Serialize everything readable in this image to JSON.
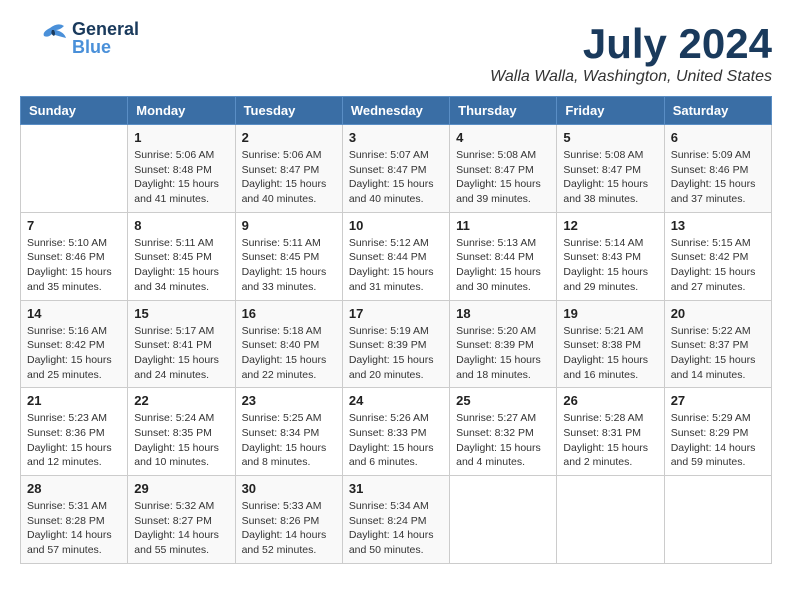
{
  "header": {
    "logo_general": "General",
    "logo_blue": "Blue",
    "month_title": "July 2024",
    "location": "Walla Walla, Washington, United States"
  },
  "days_of_week": [
    "Sunday",
    "Monday",
    "Tuesday",
    "Wednesday",
    "Thursday",
    "Friday",
    "Saturday"
  ],
  "weeks": [
    [
      {
        "day": "",
        "info": ""
      },
      {
        "day": "1",
        "info": "Sunrise: 5:06 AM\nSunset: 8:48 PM\nDaylight: 15 hours\nand 41 minutes."
      },
      {
        "day": "2",
        "info": "Sunrise: 5:06 AM\nSunset: 8:47 PM\nDaylight: 15 hours\nand 40 minutes."
      },
      {
        "day": "3",
        "info": "Sunrise: 5:07 AM\nSunset: 8:47 PM\nDaylight: 15 hours\nand 40 minutes."
      },
      {
        "day": "4",
        "info": "Sunrise: 5:08 AM\nSunset: 8:47 PM\nDaylight: 15 hours\nand 39 minutes."
      },
      {
        "day": "5",
        "info": "Sunrise: 5:08 AM\nSunset: 8:47 PM\nDaylight: 15 hours\nand 38 minutes."
      },
      {
        "day": "6",
        "info": "Sunrise: 5:09 AM\nSunset: 8:46 PM\nDaylight: 15 hours\nand 37 minutes."
      }
    ],
    [
      {
        "day": "7",
        "info": "Sunrise: 5:10 AM\nSunset: 8:46 PM\nDaylight: 15 hours\nand 35 minutes."
      },
      {
        "day": "8",
        "info": "Sunrise: 5:11 AM\nSunset: 8:45 PM\nDaylight: 15 hours\nand 34 minutes."
      },
      {
        "day": "9",
        "info": "Sunrise: 5:11 AM\nSunset: 8:45 PM\nDaylight: 15 hours\nand 33 minutes."
      },
      {
        "day": "10",
        "info": "Sunrise: 5:12 AM\nSunset: 8:44 PM\nDaylight: 15 hours\nand 31 minutes."
      },
      {
        "day": "11",
        "info": "Sunrise: 5:13 AM\nSunset: 8:44 PM\nDaylight: 15 hours\nand 30 minutes."
      },
      {
        "day": "12",
        "info": "Sunrise: 5:14 AM\nSunset: 8:43 PM\nDaylight: 15 hours\nand 29 minutes."
      },
      {
        "day": "13",
        "info": "Sunrise: 5:15 AM\nSunset: 8:42 PM\nDaylight: 15 hours\nand 27 minutes."
      }
    ],
    [
      {
        "day": "14",
        "info": "Sunrise: 5:16 AM\nSunset: 8:42 PM\nDaylight: 15 hours\nand 25 minutes."
      },
      {
        "day": "15",
        "info": "Sunrise: 5:17 AM\nSunset: 8:41 PM\nDaylight: 15 hours\nand 24 minutes."
      },
      {
        "day": "16",
        "info": "Sunrise: 5:18 AM\nSunset: 8:40 PM\nDaylight: 15 hours\nand 22 minutes."
      },
      {
        "day": "17",
        "info": "Sunrise: 5:19 AM\nSunset: 8:39 PM\nDaylight: 15 hours\nand 20 minutes."
      },
      {
        "day": "18",
        "info": "Sunrise: 5:20 AM\nSunset: 8:39 PM\nDaylight: 15 hours\nand 18 minutes."
      },
      {
        "day": "19",
        "info": "Sunrise: 5:21 AM\nSunset: 8:38 PM\nDaylight: 15 hours\nand 16 minutes."
      },
      {
        "day": "20",
        "info": "Sunrise: 5:22 AM\nSunset: 8:37 PM\nDaylight: 15 hours\nand 14 minutes."
      }
    ],
    [
      {
        "day": "21",
        "info": "Sunrise: 5:23 AM\nSunset: 8:36 PM\nDaylight: 15 hours\nand 12 minutes."
      },
      {
        "day": "22",
        "info": "Sunrise: 5:24 AM\nSunset: 8:35 PM\nDaylight: 15 hours\nand 10 minutes."
      },
      {
        "day": "23",
        "info": "Sunrise: 5:25 AM\nSunset: 8:34 PM\nDaylight: 15 hours\nand 8 minutes."
      },
      {
        "day": "24",
        "info": "Sunrise: 5:26 AM\nSunset: 8:33 PM\nDaylight: 15 hours\nand 6 minutes."
      },
      {
        "day": "25",
        "info": "Sunrise: 5:27 AM\nSunset: 8:32 PM\nDaylight: 15 hours\nand 4 minutes."
      },
      {
        "day": "26",
        "info": "Sunrise: 5:28 AM\nSunset: 8:31 PM\nDaylight: 15 hours\nand 2 minutes."
      },
      {
        "day": "27",
        "info": "Sunrise: 5:29 AM\nSunset: 8:29 PM\nDaylight: 14 hours\nand 59 minutes."
      }
    ],
    [
      {
        "day": "28",
        "info": "Sunrise: 5:31 AM\nSunset: 8:28 PM\nDaylight: 14 hours\nand 57 minutes."
      },
      {
        "day": "29",
        "info": "Sunrise: 5:32 AM\nSunset: 8:27 PM\nDaylight: 14 hours\nand 55 minutes."
      },
      {
        "day": "30",
        "info": "Sunrise: 5:33 AM\nSunset: 8:26 PM\nDaylight: 14 hours\nand 52 minutes."
      },
      {
        "day": "31",
        "info": "Sunrise: 5:34 AM\nSunset: 8:24 PM\nDaylight: 14 hours\nand 50 minutes."
      },
      {
        "day": "",
        "info": ""
      },
      {
        "day": "",
        "info": ""
      },
      {
        "day": "",
        "info": ""
      }
    ]
  ]
}
